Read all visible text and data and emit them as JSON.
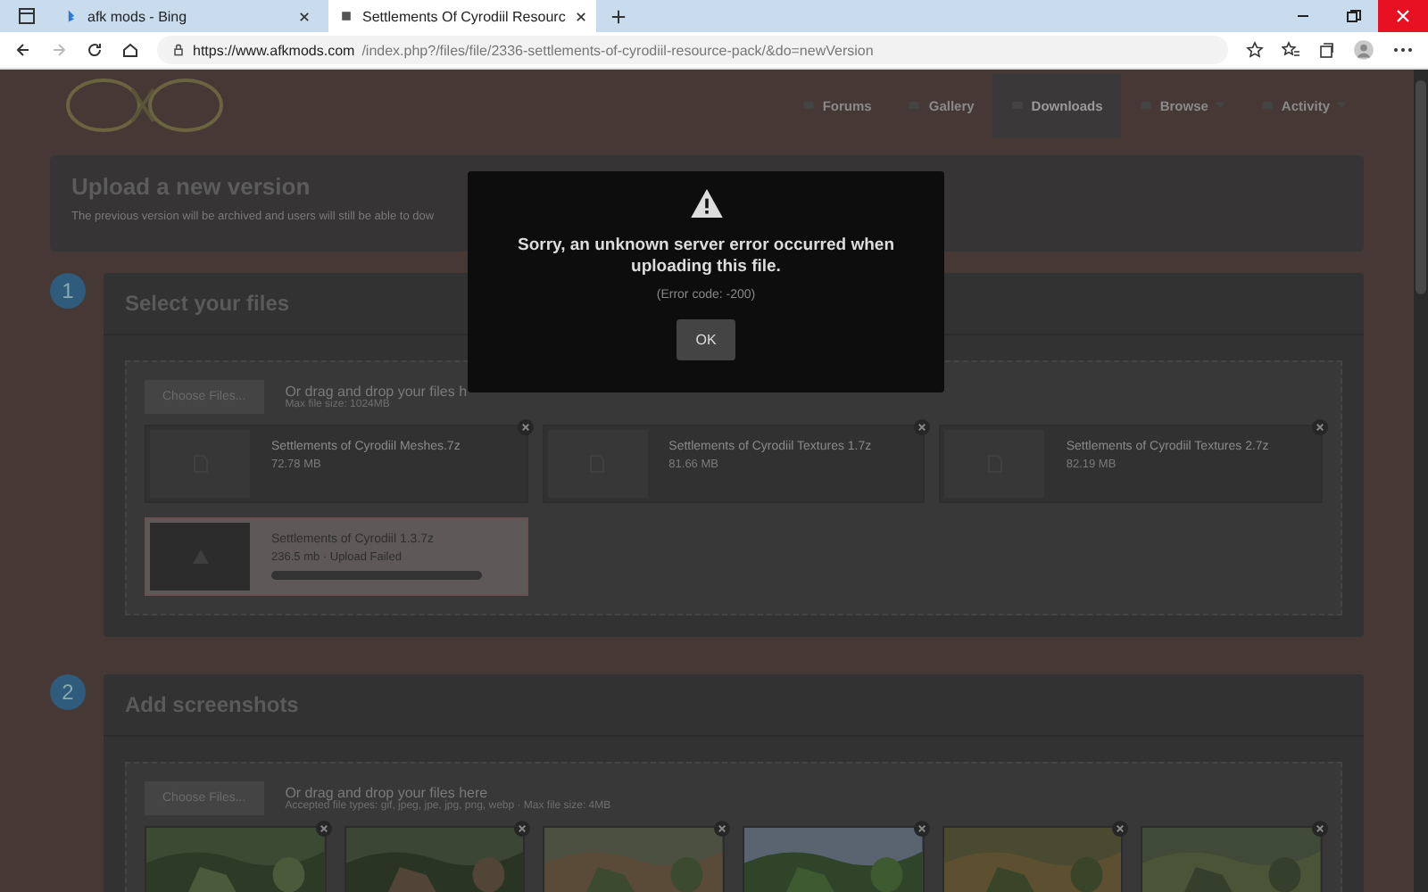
{
  "browser": {
    "tabs": [
      {
        "title": "afk mods - Bing",
        "selected": false
      },
      {
        "title": "Settlements Of Cyrodiil Resourc",
        "selected": true
      }
    ],
    "url_host": "https://www.afkmods.com",
    "url_path": "/index.php?/files/file/2336-settlements-of-cyrodiil-resource-pack/&do=newVersion"
  },
  "site_nav": [
    {
      "label": "Forums",
      "selected": false,
      "dropdown": false
    },
    {
      "label": "Gallery",
      "selected": false,
      "dropdown": false
    },
    {
      "label": "Downloads",
      "selected": true,
      "dropdown": false
    },
    {
      "label": "Browse",
      "selected": false,
      "dropdown": true
    },
    {
      "label": "Activity",
      "selected": false,
      "dropdown": true
    }
  ],
  "header": {
    "title": "Upload a new version",
    "subtitle": "The previous version will be archived and users will still be able to dow"
  },
  "steps": [
    {
      "number": "1",
      "title": "Select your files",
      "button": "Choose Files...",
      "hint": "Or drag and drop your files h",
      "sub": "Max file size: 1024MB",
      "files": [
        {
          "kind": "file",
          "name": "Settlements of Cyrodiil Meshes.7z",
          "size": "72.78 MB"
        },
        {
          "kind": "file",
          "name": "Settlements of Cyrodiil Textures 1.7z",
          "size": "81.66 MB"
        },
        {
          "kind": "file",
          "name": "Settlements of Cyrodiil Textures 2.7z",
          "size": "82.19 MB"
        },
        {
          "kind": "failed",
          "name": "Settlements of Cyrodiil 1.3.7z",
          "size": "236.5 mb · Upload Failed",
          "level": 1
        }
      ]
    },
    {
      "number": "2",
      "title": "Add screenshots",
      "button": "Choose Files...",
      "hint": "Or drag and drop your files here",
      "sub": "Accepted file types: gif, jpeg, jpe, jpg, png, webp · Max file size: 4MB"
    }
  ],
  "modal": {
    "message": "Sorry, an unknown server error occurred when uploading this file.",
    "code": "(Error code: -200)",
    "button": "OK"
  }
}
